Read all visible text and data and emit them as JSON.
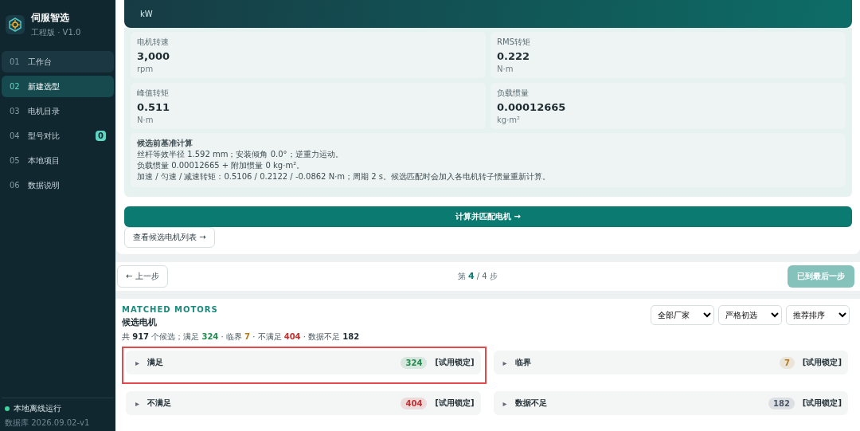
{
  "sidebar": {
    "app_name": "伺服智选",
    "edition": "工程版 · V1.0",
    "items": [
      {
        "number": "01",
        "label": "工作台",
        "selected": false,
        "hovered": true
      },
      {
        "number": "02",
        "label": "新建选型",
        "selected": true
      },
      {
        "number": "03",
        "label": "电机目录",
        "selected": false
      },
      {
        "number": "04",
        "label": "型号对比",
        "selected": false,
        "badge": "0"
      },
      {
        "number": "05",
        "label": "本地项目",
        "selected": false
      },
      {
        "number": "06",
        "label": "数据说明",
        "selected": false
      }
    ],
    "status": "本地离线运行",
    "db_version": "数据库 2026.09.02-v1"
  },
  "banner": {
    "unit": "kW"
  },
  "metrics": [
    {
      "label": "电机转速",
      "value": "3,000",
      "unit": "rpm"
    },
    {
      "label": "RMS转矩",
      "value": "0.222",
      "unit": "N·m"
    },
    {
      "label": "峰值转矩",
      "value": "0.511",
      "unit": "N·m"
    },
    {
      "label": "负载惯量",
      "value": "0.00012665",
      "unit": "kg·m²"
    }
  ],
  "note": {
    "title": "候选前基准计算",
    "lines": [
      "丝杆等效半径 1.592 mm；安装倾角 0.0°；逆重力运动。",
      "负载惯量 0.00012665 + 附加惯量 0 kg·m²。",
      "加速 / 匀速 / 减速转矩：0.5106 / 0.2122 / -0.0862 N·m；周期 2 s。候选匹配时会加入各电机转子惯量重新计算。"
    ]
  },
  "compute_button": "计算并匹配电机 →",
  "list_button": "查看候选电机列表 →",
  "step_nav": {
    "prev": "← 上一步",
    "step_prefix": "第",
    "step_current": "4",
    "step_suffix": "/ 4 步",
    "next": "已到最后一步",
    "next_disabled": true
  },
  "results": {
    "eyebrow": "MATCHED MOTORS",
    "title": "候选电机",
    "summary": [
      {
        "text": "共 ",
        "kind": "plain"
      },
      {
        "text": "917",
        "kind": "bold"
      },
      {
        "text": " 个候选；满足 ",
        "kind": "plain"
      },
      {
        "text": "324",
        "kind": "good"
      },
      {
        "text": " · 临界 ",
        "kind": "plain"
      },
      {
        "text": "7",
        "kind": "warn"
      },
      {
        "text": " · 不满足 ",
        "kind": "plain"
      },
      {
        "text": "404",
        "kind": "bad"
      },
      {
        "text": " · 数据不足 ",
        "kind": "plain"
      },
      {
        "text": "182",
        "kind": "bold"
      }
    ],
    "filters": [
      {
        "value": "全部厂家"
      },
      {
        "value": "严格初选"
      },
      {
        "value": "推荐排序"
      }
    ],
    "groups": [
      {
        "marker": "▸",
        "label": "满足",
        "count": "324",
        "color": "#1e8a4c",
        "tag": "[试用锁定]",
        "highlighted": true
      },
      {
        "marker": "▸",
        "label": "临界",
        "count": "7",
        "color": "#b7791f",
        "tag": "[试用锁定]",
        "highlighted": false
      },
      {
        "marker": "▸",
        "label": "不满足",
        "count": "404",
        "color": "#c53030",
        "tag": "[试用锁定]",
        "highlighted": false
      },
      {
        "marker": "▸",
        "label": "数据不足",
        "count": "182",
        "color": "#4a5568",
        "tag": "[试用锁定]",
        "highlighted": false
      }
    ]
  }
}
